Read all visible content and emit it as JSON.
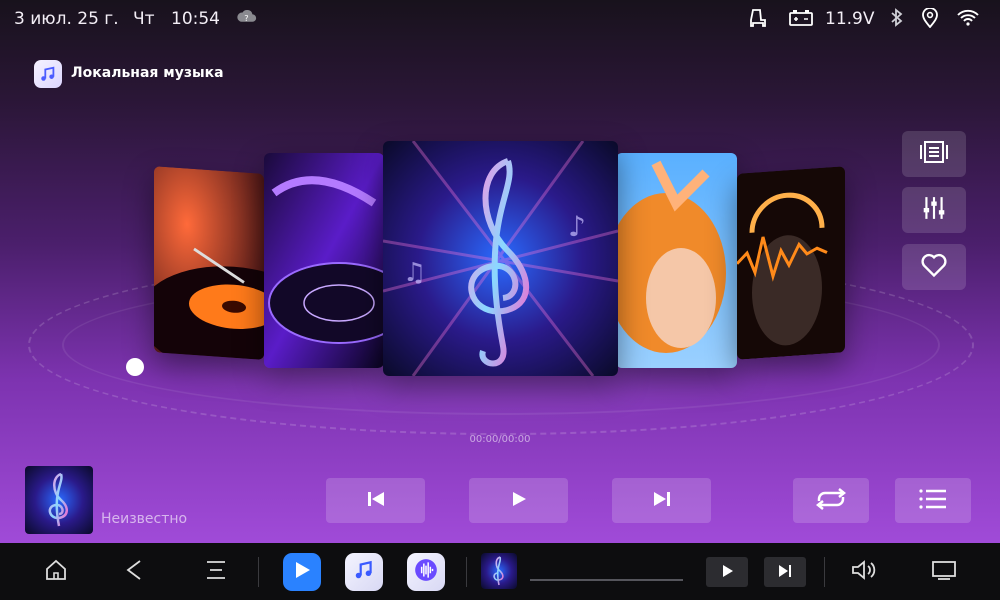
{
  "status_bar": {
    "date": "3 июл. 25 г.",
    "weekday": "Чт",
    "time": "10:54",
    "voltage": "11.9V",
    "icons": [
      "weather-cloud-icon",
      "seat-icon",
      "battery-icon",
      "bluetooth-icon",
      "location-icon",
      "wifi-icon"
    ]
  },
  "app": {
    "title": "Локальная музыка",
    "icon": "music-note-icon"
  },
  "player": {
    "time_display": "00:00/00:00",
    "artist": "Неизвестно",
    "controls": [
      "previous-icon",
      "play-icon",
      "next-icon",
      "repeat-icon",
      "playlist-icon"
    ]
  },
  "side_buttons": [
    "cover-flow-icon",
    "equalizer-icon",
    "heart-icon"
  ],
  "navbar": {
    "items": [
      "home-icon",
      "back-icon",
      "menu-icon",
      "video-player-app",
      "music-app",
      "voice-app",
      "play-icon",
      "next-icon",
      "volume-icon",
      "screen-icon"
    ]
  },
  "colors": {
    "accent": "#a04bd8",
    "navbar_bg": "#0d0d0f"
  }
}
